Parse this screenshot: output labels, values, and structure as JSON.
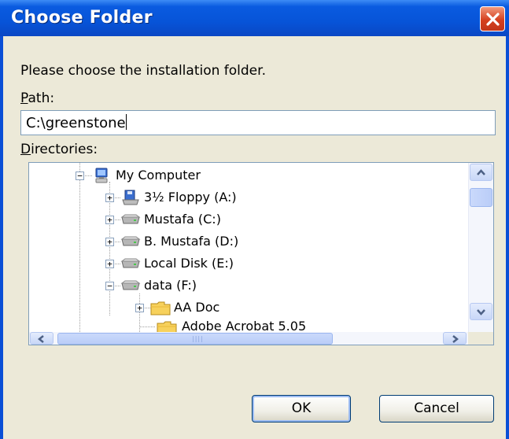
{
  "window": {
    "title": "Choose Folder"
  },
  "prompt": "Please choose the installation folder.",
  "path": {
    "label_key": "P",
    "label_rest": "ath:",
    "value": "C:\\greenstone"
  },
  "directories": {
    "label_key": "D",
    "label_rest": "irectories:",
    "tree": [
      {
        "label": "My Computer",
        "icon": "my-computer-icon",
        "expander": "minus"
      },
      {
        "label": "3½ Floppy (A:)",
        "icon": "floppy-drive-icon",
        "expander": "plus"
      },
      {
        "label": "Mustafa (C:)",
        "icon": "hard-drive-icon",
        "expander": "plus"
      },
      {
        "label": "B. Mustafa (D:)",
        "icon": "hard-drive-icon",
        "expander": "plus"
      },
      {
        "label": "Local Disk (E:)",
        "icon": "hard-drive-icon",
        "expander": "plus"
      },
      {
        "label": "data (F:)",
        "icon": "hard-drive-icon",
        "expander": "minus"
      },
      {
        "label": "AA Doc",
        "icon": "folder-icon",
        "expander": "plus"
      },
      {
        "label": "Adobe Acrobat 5.05",
        "icon": "folder-icon",
        "expander": "none"
      }
    ]
  },
  "buttons": {
    "ok": "OK",
    "cancel": "Cancel"
  },
  "colors": {
    "title_bar": "#0754d8",
    "dialog_bg": "#ece9d8",
    "close_button": "#d5401f"
  }
}
